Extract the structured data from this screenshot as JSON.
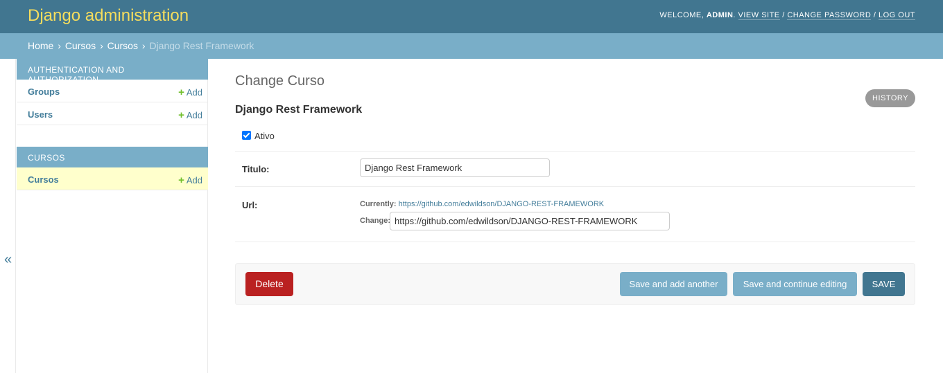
{
  "header": {
    "title": "Django administration",
    "welcome": "Welcome,",
    "user": "admin",
    "view_site": "View site",
    "change_password": "Change password",
    "log_out": "Log out"
  },
  "breadcrumbs": {
    "home": "Home",
    "app": "Cursos",
    "model": "Cursos",
    "current": "Django Rest Framework",
    "separator": "›"
  },
  "sidebar": {
    "auth_caption": "Authentication and Authorization",
    "groups": "Groups",
    "users": "Users",
    "cursos_caption": "Cursos",
    "cursos": "Cursos",
    "add_label": "Add",
    "toggle": "«"
  },
  "content": {
    "title": "Change Curso",
    "object_title": "Django Rest Framework",
    "history": "History",
    "ativo_label": "Ativo",
    "ativo_checked": true,
    "titulo_label": "Titulo:",
    "titulo_value": "Django Rest Framework",
    "url_label": "Url:",
    "currently_label": "Currently:",
    "currently_link": "https://github.com/edwildson/DJANGO-REST-FRAMEWORK",
    "change_label": "Change:",
    "url_value": "https://github.com/edwildson/DJANGO-REST-FRAMEWORK"
  },
  "actions": {
    "delete": "Delete",
    "save_add": "Save and add another",
    "save_continue": "Save and continue editing",
    "save": "Save"
  },
  "colors": {
    "header_bg": "#417690",
    "brand_text": "#f5dd5d",
    "breadcrumb_bg": "#79aec8",
    "delete_bg": "#ba2121",
    "save_bg": "#417690",
    "secondary_bg": "#79aec8",
    "current_row_bg": "#ffffcc"
  }
}
